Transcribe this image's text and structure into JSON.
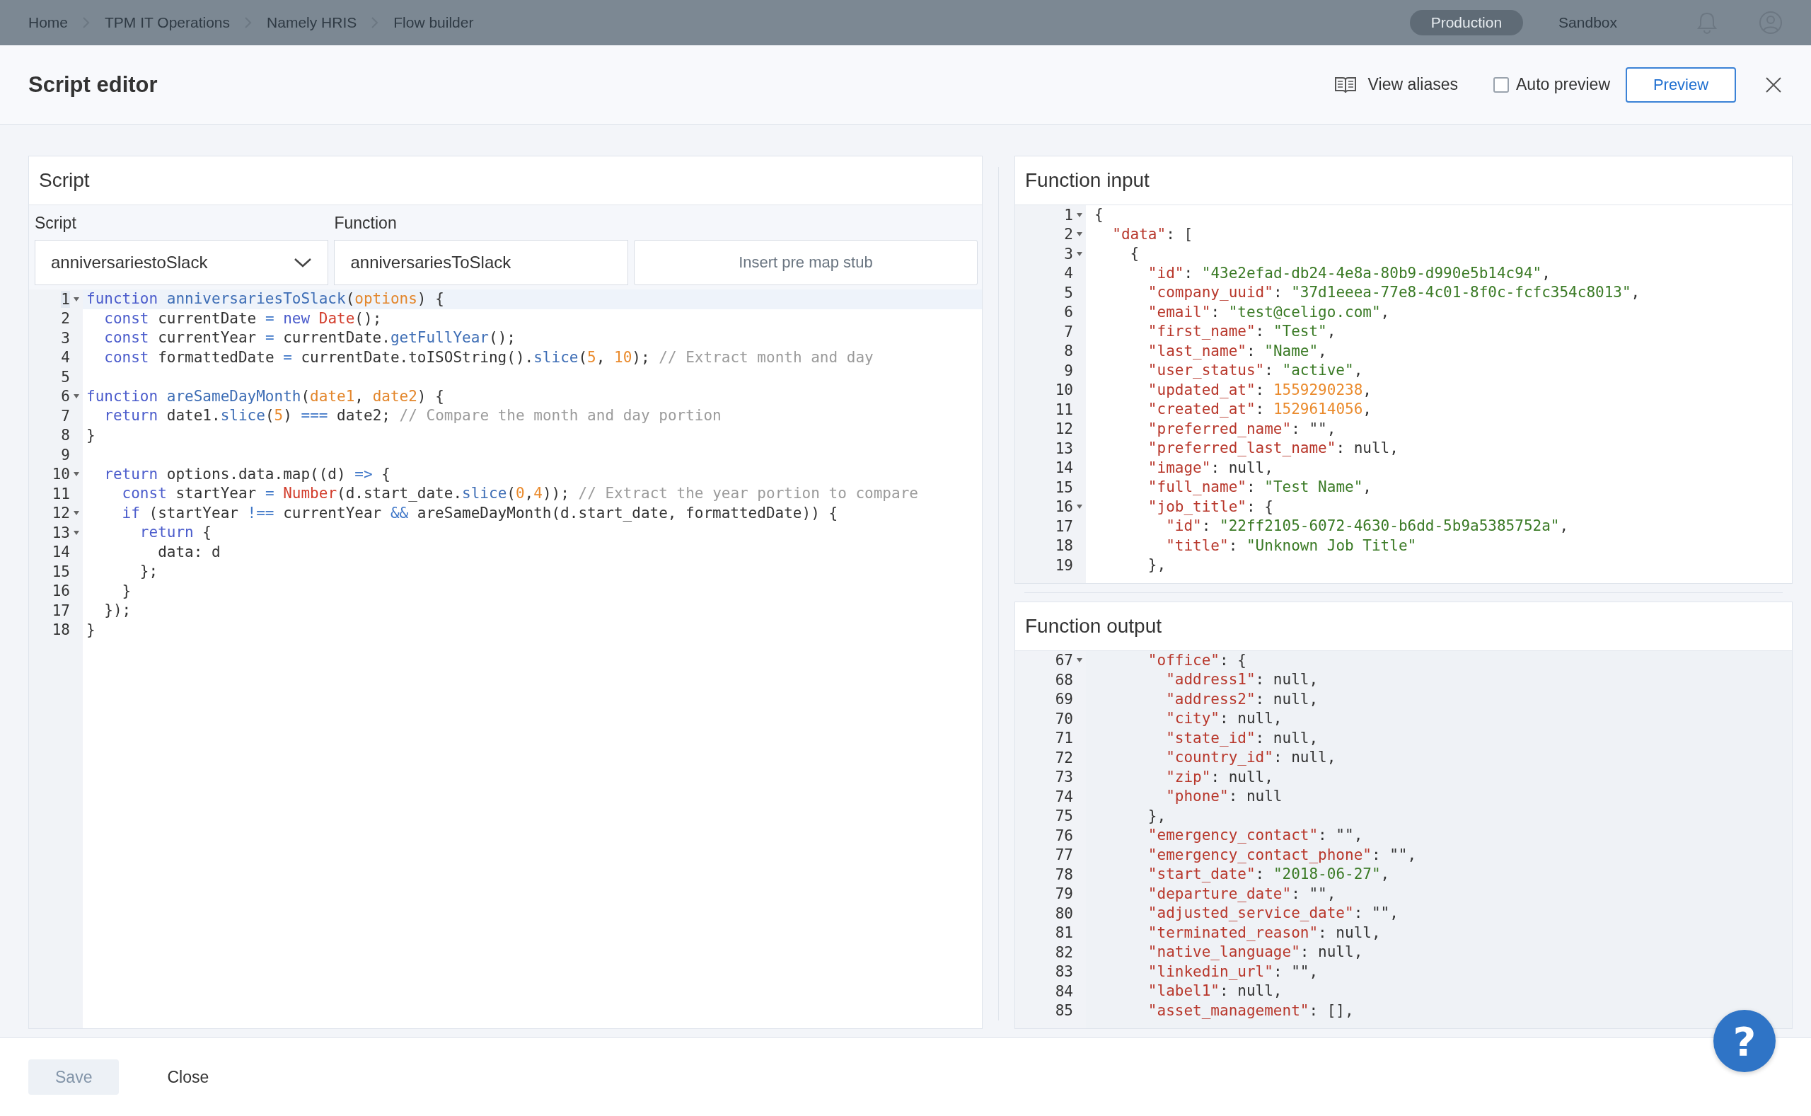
{
  "top_bar": {
    "breadcrumbs": [
      "Home",
      "TPM IT Operations",
      "Namely HRIS",
      "Flow builder"
    ],
    "environments": [
      {
        "label": "Production",
        "selected": true
      },
      {
        "label": "Sandbox",
        "selected": false
      }
    ]
  },
  "drawer": {
    "title": "Script editor",
    "view_aliases": "View aliases",
    "auto_preview": {
      "label": "Auto preview",
      "checked": false
    },
    "preview_button": "Preview"
  },
  "script_panel": {
    "title": "Script",
    "script_label": "Script",
    "script_value": "anniversariestoSlack",
    "function_label": "Function",
    "function_value": "anniversariesToSlack",
    "stub_button": "Insert pre map stub",
    "lines": [
      {
        "number": "1",
        "fold": true,
        "selected": true,
        "tokens": [
          {
            "kind": "keyword",
            "text": "function "
          },
          {
            "kind": "name",
            "text": "anniversariesToSlack"
          },
          {
            "kind": "plain",
            "text": "("
          },
          {
            "kind": "param",
            "text": "options"
          },
          {
            "kind": "plain",
            "text": ") {"
          }
        ]
      },
      {
        "number": "2",
        "fold": false,
        "selected": false,
        "tokens": [
          {
            "kind": "keyword",
            "text": "  const"
          },
          {
            "kind": "plain",
            "text": " currentDate "
          },
          {
            "kind": "operator",
            "text": "="
          },
          {
            "kind": "keyword",
            "text": " new "
          },
          {
            "kind": "builtin",
            "text": "Date"
          },
          {
            "kind": "plain",
            "text": "();"
          }
        ]
      },
      {
        "number": "3",
        "fold": false,
        "selected": false,
        "tokens": [
          {
            "kind": "keyword",
            "text": "  const"
          },
          {
            "kind": "plain",
            "text": " currentYear "
          },
          {
            "kind": "operator",
            "text": "="
          },
          {
            "kind": "plain",
            "text": " currentDate."
          },
          {
            "kind": "name",
            "text": "getFullYear"
          },
          {
            "kind": "plain",
            "text": "();"
          }
        ]
      },
      {
        "number": "4",
        "fold": false,
        "selected": false,
        "tokens": [
          {
            "kind": "keyword",
            "text": "  const"
          },
          {
            "kind": "plain",
            "text": " formattedDate "
          },
          {
            "kind": "operator",
            "text": "="
          },
          {
            "kind": "plain",
            "text": " currentDate.toISOString()."
          },
          {
            "kind": "name",
            "text": "slice"
          },
          {
            "kind": "plain",
            "text": "("
          },
          {
            "kind": "number",
            "text": "5"
          },
          {
            "kind": "plain",
            "text": ", "
          },
          {
            "kind": "number",
            "text": "10"
          },
          {
            "kind": "plain",
            "text": "); "
          },
          {
            "kind": "comment",
            "text": "// Extract month and day"
          }
        ]
      },
      {
        "number": "5",
        "fold": false,
        "selected": false
      },
      {
        "number": "6",
        "fold": true,
        "selected": false,
        "tokens": [
          {
            "kind": "keyword",
            "text": "function "
          },
          {
            "kind": "name",
            "text": "areSameDayMonth"
          },
          {
            "kind": "plain",
            "text": "("
          },
          {
            "kind": "param",
            "text": "date1"
          },
          {
            "kind": "plain",
            "text": ", "
          },
          {
            "kind": "param",
            "text": "date2"
          },
          {
            "kind": "plain",
            "text": ") {"
          }
        ]
      },
      {
        "number": "7",
        "fold": false,
        "selected": false,
        "tokens": [
          {
            "kind": "keyword",
            "text": "  return"
          },
          {
            "kind": "plain",
            "text": " date1."
          },
          {
            "kind": "name",
            "text": "slice"
          },
          {
            "kind": "plain",
            "text": "("
          },
          {
            "kind": "number",
            "text": "5"
          },
          {
            "kind": "plain",
            "text": ") "
          },
          {
            "kind": "operator",
            "text": "==="
          },
          {
            "kind": "plain",
            "text": " date2; "
          },
          {
            "kind": "comment",
            "text": "// Compare the month and day portion"
          }
        ]
      },
      {
        "number": "8",
        "fold": false,
        "selected": false,
        "tokens": [
          {
            "kind": "plain",
            "text": "}"
          }
        ]
      },
      {
        "number": "9",
        "fold": false,
        "selected": false
      },
      {
        "number": "10",
        "fold": true,
        "selected": false,
        "tokens": [
          {
            "kind": "keyword",
            "text": "  return"
          },
          {
            "kind": "plain",
            "text": " options.data.map((d) "
          },
          {
            "kind": "operator",
            "text": "=>"
          },
          {
            "kind": "plain",
            "text": " {"
          }
        ]
      },
      {
        "number": "11",
        "fold": false,
        "selected": false,
        "tokens": [
          {
            "kind": "keyword",
            "text": "    const"
          },
          {
            "kind": "plain",
            "text": " startYear "
          },
          {
            "kind": "operator",
            "text": "="
          },
          {
            "kind": "builtin",
            "text": " Number"
          },
          {
            "kind": "plain",
            "text": "(d.start_date."
          },
          {
            "kind": "name",
            "text": "slice"
          },
          {
            "kind": "plain",
            "text": "("
          },
          {
            "kind": "number",
            "text": "0"
          },
          {
            "kind": "plain",
            "text": ","
          },
          {
            "kind": "number",
            "text": "4"
          },
          {
            "kind": "plain",
            "text": ")); "
          },
          {
            "kind": "comment",
            "text": "// Extract the year portion to compare"
          }
        ]
      },
      {
        "number": "12",
        "fold": true,
        "selected": false,
        "tokens": [
          {
            "kind": "keyword",
            "text": "    if"
          },
          {
            "kind": "plain",
            "text": " (startYear "
          },
          {
            "kind": "operator",
            "text": "!=="
          },
          {
            "kind": "plain",
            "text": " currentYear "
          },
          {
            "kind": "operator",
            "text": "&&"
          },
          {
            "kind": "plain",
            "text": " areSameDayMonth(d.start_date, formattedDate)) {"
          }
        ]
      },
      {
        "number": "13",
        "fold": true,
        "selected": false,
        "tokens": [
          {
            "kind": "keyword",
            "text": "      return"
          },
          {
            "kind": "plain",
            "text": " {"
          }
        ]
      },
      {
        "number": "14",
        "fold": false,
        "selected": false,
        "tokens": [
          {
            "kind": "plain",
            "text": "        data: d"
          }
        ]
      },
      {
        "number": "15",
        "fold": false,
        "selected": false,
        "tokens": [
          {
            "kind": "plain",
            "text": "      };"
          }
        ]
      },
      {
        "number": "16",
        "fold": false,
        "selected": false,
        "tokens": [
          {
            "kind": "plain",
            "text": "    }"
          }
        ]
      },
      {
        "number": "17",
        "fold": false,
        "selected": false,
        "tokens": [
          {
            "kind": "plain",
            "text": "  });"
          }
        ]
      },
      {
        "number": "18",
        "fold": false,
        "selected": false,
        "tokens": [
          {
            "kind": "plain",
            "text": "}"
          }
        ]
      }
    ]
  },
  "input_panel": {
    "title": "Function input",
    "lines": [
      {
        "number": "1",
        "fold": true,
        "tokens": [
          {
            "kind": "plain",
            "text": "{"
          }
        ]
      },
      {
        "number": "2",
        "fold": true,
        "tokens": [
          {
            "kind": "key",
            "text": "  \"data\""
          },
          {
            "kind": "plain",
            "text": ": ["
          }
        ]
      },
      {
        "number": "3",
        "fold": true,
        "tokens": [
          {
            "kind": "plain",
            "text": "    {"
          }
        ]
      },
      {
        "number": "4",
        "fold": false,
        "tokens": [
          {
            "kind": "key",
            "text": "      \"id\""
          },
          {
            "kind": "plain",
            "text": ": "
          },
          {
            "kind": "string",
            "text": "\"43e2efad-db24-4e8a-80b9-d990e5b14c94\""
          },
          {
            "kind": "plain",
            "text": ","
          }
        ]
      },
      {
        "number": "5",
        "fold": false,
        "tokens": [
          {
            "kind": "key",
            "text": "      \"company_uuid\""
          },
          {
            "kind": "plain",
            "text": ": "
          },
          {
            "kind": "string",
            "text": "\"37d1eeea-77e8-4c01-8f0c-fcfc354c8013\""
          },
          {
            "kind": "plain",
            "text": ","
          }
        ]
      },
      {
        "number": "6",
        "fold": false,
        "tokens": [
          {
            "kind": "key",
            "text": "      \"email\""
          },
          {
            "kind": "plain",
            "text": ": "
          },
          {
            "kind": "string",
            "text": "\"test@celigo.com\""
          },
          {
            "kind": "plain",
            "text": ","
          }
        ]
      },
      {
        "number": "7",
        "fold": false,
        "tokens": [
          {
            "kind": "key",
            "text": "      \"first_name\""
          },
          {
            "kind": "plain",
            "text": ": "
          },
          {
            "kind": "string",
            "text": "\"Test\""
          },
          {
            "kind": "plain",
            "text": ","
          }
        ]
      },
      {
        "number": "8",
        "fold": false,
        "tokens": [
          {
            "kind": "key",
            "text": "      \"last_name\""
          },
          {
            "kind": "plain",
            "text": ": "
          },
          {
            "kind": "string",
            "text": "\"Name\""
          },
          {
            "kind": "plain",
            "text": ","
          }
        ]
      },
      {
        "number": "9",
        "fold": false,
        "tokens": [
          {
            "kind": "key",
            "text": "      \"user_status\""
          },
          {
            "kind": "plain",
            "text": ": "
          },
          {
            "kind": "string",
            "text": "\"active\""
          },
          {
            "kind": "plain",
            "text": ","
          }
        ]
      },
      {
        "number": "10",
        "fold": false,
        "tokens": [
          {
            "kind": "key",
            "text": "      \"updated_at\""
          },
          {
            "kind": "plain",
            "text": ": "
          },
          {
            "kind": "number",
            "text": "1559290238"
          },
          {
            "kind": "plain",
            "text": ","
          }
        ]
      },
      {
        "number": "11",
        "fold": false,
        "tokens": [
          {
            "kind": "key",
            "text": "      \"created_at\""
          },
          {
            "kind": "plain",
            "text": ": "
          },
          {
            "kind": "number",
            "text": "1529614056"
          },
          {
            "kind": "plain",
            "text": ","
          }
        ]
      },
      {
        "number": "12",
        "fold": false,
        "tokens": [
          {
            "kind": "key",
            "text": "      \"preferred_name\""
          },
          {
            "kind": "plain",
            "text": ": \"\","
          }
        ]
      },
      {
        "number": "13",
        "fold": false,
        "tokens": [
          {
            "kind": "key",
            "text": "      \"preferred_last_name\""
          },
          {
            "kind": "plain",
            "text": ": null,"
          }
        ]
      },
      {
        "number": "14",
        "fold": false,
        "tokens": [
          {
            "kind": "key",
            "text": "      \"image\""
          },
          {
            "kind": "plain",
            "text": ": null,"
          }
        ]
      },
      {
        "number": "15",
        "fold": false,
        "tokens": [
          {
            "kind": "key",
            "text": "      \"full_name\""
          },
          {
            "kind": "plain",
            "text": ": "
          },
          {
            "kind": "string",
            "text": "\"Test Name\""
          },
          {
            "kind": "plain",
            "text": ","
          }
        ]
      },
      {
        "number": "16",
        "fold": true,
        "tokens": [
          {
            "kind": "key",
            "text": "      \"job_title\""
          },
          {
            "kind": "plain",
            "text": ": {"
          }
        ]
      },
      {
        "number": "17",
        "fold": false,
        "tokens": [
          {
            "kind": "key",
            "text": "        \"id\""
          },
          {
            "kind": "plain",
            "text": ": "
          },
          {
            "kind": "string",
            "text": "\"22ff2105-6072-4630-b6dd-5b9a5385752a\""
          },
          {
            "kind": "plain",
            "text": ","
          }
        ]
      },
      {
        "number": "18",
        "fold": false,
        "tokens": [
          {
            "kind": "key",
            "text": "        \"title\""
          },
          {
            "kind": "plain",
            "text": ": "
          },
          {
            "kind": "string",
            "text": "\"Unknown Job Title\""
          }
        ]
      },
      {
        "number": "19",
        "fold": false,
        "tokens": [
          {
            "kind": "plain",
            "text": "      },"
          }
        ]
      }
    ]
  },
  "output_panel": {
    "title": "Function output",
    "lines": [
      {
        "number": "67",
        "fold": true,
        "tokens": [
          {
            "kind": "key",
            "text": "      \"office\""
          },
          {
            "kind": "plain",
            "text": ": {"
          }
        ]
      },
      {
        "number": "68",
        "fold": false,
        "tokens": [
          {
            "kind": "key",
            "text": "        \"address1\""
          },
          {
            "kind": "plain",
            "text": ": null,"
          }
        ]
      },
      {
        "number": "69",
        "fold": false,
        "tokens": [
          {
            "kind": "key",
            "text": "        \"address2\""
          },
          {
            "kind": "plain",
            "text": ": null,"
          }
        ]
      },
      {
        "number": "70",
        "fold": false,
        "tokens": [
          {
            "kind": "key",
            "text": "        \"city\""
          },
          {
            "kind": "plain",
            "text": ": null,"
          }
        ]
      },
      {
        "number": "71",
        "fold": false,
        "tokens": [
          {
            "kind": "key",
            "text": "        \"state_id\""
          },
          {
            "kind": "plain",
            "text": ": null,"
          }
        ]
      },
      {
        "number": "72",
        "fold": false,
        "tokens": [
          {
            "kind": "key",
            "text": "        \"country_id\""
          },
          {
            "kind": "plain",
            "text": ": null,"
          }
        ]
      },
      {
        "number": "73",
        "fold": false,
        "tokens": [
          {
            "kind": "key",
            "text": "        \"zip\""
          },
          {
            "kind": "plain",
            "text": ": null,"
          }
        ]
      },
      {
        "number": "74",
        "fold": false,
        "tokens": [
          {
            "kind": "key",
            "text": "        \"phone\""
          },
          {
            "kind": "plain",
            "text": ": null"
          }
        ]
      },
      {
        "number": "75",
        "fold": false,
        "tokens": [
          {
            "kind": "plain",
            "text": "      },"
          }
        ]
      },
      {
        "number": "76",
        "fold": false,
        "tokens": [
          {
            "kind": "key",
            "text": "      \"emergency_contact\""
          },
          {
            "kind": "plain",
            "text": ": \"\","
          }
        ]
      },
      {
        "number": "77",
        "fold": false,
        "tokens": [
          {
            "kind": "key",
            "text": "      \"emergency_contact_phone\""
          },
          {
            "kind": "plain",
            "text": ": \"\","
          }
        ]
      },
      {
        "number": "78",
        "fold": false,
        "tokens": [
          {
            "kind": "key",
            "text": "      \"start_date\""
          },
          {
            "kind": "plain",
            "text": ": "
          },
          {
            "kind": "string",
            "text": "\"2018-06-27\""
          },
          {
            "kind": "plain",
            "text": ","
          }
        ]
      },
      {
        "number": "79",
        "fold": false,
        "tokens": [
          {
            "kind": "key",
            "text": "      \"departure_date\""
          },
          {
            "kind": "plain",
            "text": ": \"\","
          }
        ]
      },
      {
        "number": "80",
        "fold": false,
        "tokens": [
          {
            "kind": "key",
            "text": "      \"adjusted_service_date\""
          },
          {
            "kind": "plain",
            "text": ": \"\","
          }
        ]
      },
      {
        "number": "81",
        "fold": false,
        "tokens": [
          {
            "kind": "key",
            "text": "      \"terminated_reason\""
          },
          {
            "kind": "plain",
            "text": ": null,"
          }
        ]
      },
      {
        "number": "82",
        "fold": false,
        "tokens": [
          {
            "kind": "key",
            "text": "      \"native_language\""
          },
          {
            "kind": "plain",
            "text": ": null,"
          }
        ]
      },
      {
        "number": "83",
        "fold": false,
        "tokens": [
          {
            "kind": "key",
            "text": "      \"linkedin_url\""
          },
          {
            "kind": "plain",
            "text": ": \"\","
          }
        ]
      },
      {
        "number": "84",
        "fold": false,
        "tokens": [
          {
            "kind": "key",
            "text": "      \"label1\""
          },
          {
            "kind": "plain",
            "text": ": null,"
          }
        ]
      },
      {
        "number": "85",
        "fold": false,
        "tokens": [
          {
            "kind": "key",
            "text": "      \"asset_management\""
          },
          {
            "kind": "plain",
            "text": ": [],"
          }
        ]
      }
    ]
  },
  "footer": {
    "buttons": [
      {
        "label": "Save",
        "disabled": true
      },
      {
        "label": "Close",
        "disabled": false
      }
    ]
  },
  "help_button": "?"
}
